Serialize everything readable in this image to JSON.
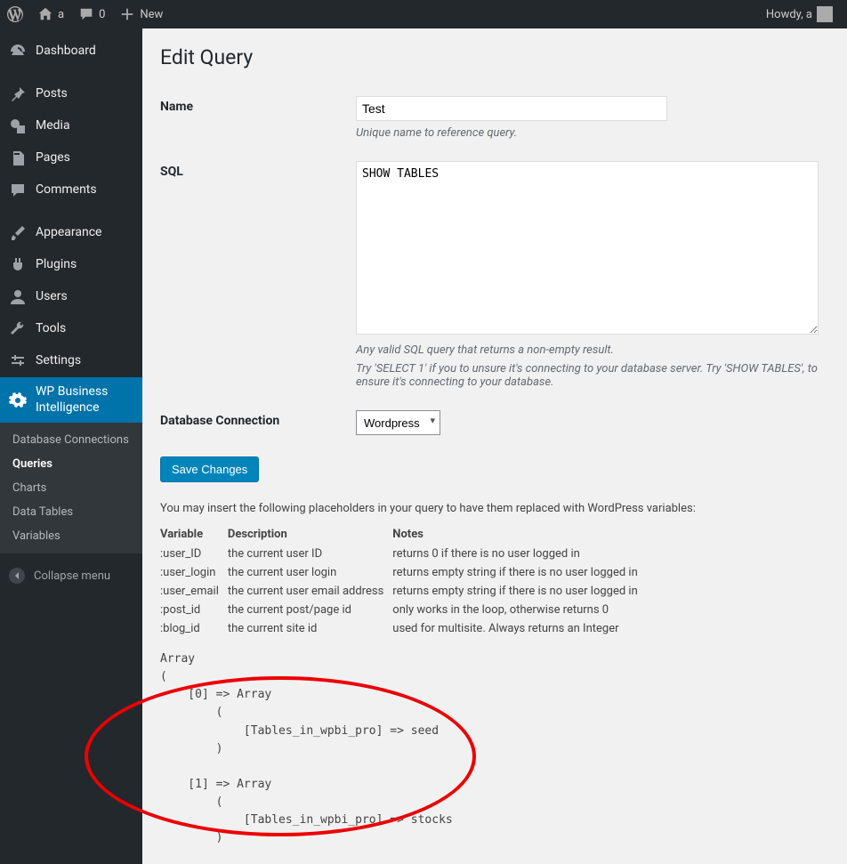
{
  "adminbar": {
    "site_name": "a",
    "comments_count": "0",
    "new_label": "New",
    "howdy": "Howdy, a"
  },
  "sidebar": {
    "items": [
      {
        "label": "Dashboard"
      },
      {
        "label": "Posts"
      },
      {
        "label": "Media"
      },
      {
        "label": "Pages"
      },
      {
        "label": "Comments"
      },
      {
        "label": "Appearance"
      },
      {
        "label": "Plugins"
      },
      {
        "label": "Users"
      },
      {
        "label": "Tools"
      },
      {
        "label": "Settings"
      },
      {
        "label": "WP Business Intelligence"
      }
    ],
    "sub": [
      {
        "label": "Database Connections"
      },
      {
        "label": "Queries"
      },
      {
        "label": "Charts"
      },
      {
        "label": "Data Tables"
      },
      {
        "label": "Variables"
      }
    ],
    "collapse": "Collapse menu"
  },
  "page": {
    "title": "Edit Query",
    "name_label": "Name",
    "name_value": "Test",
    "name_hint": "Unique name to reference query.",
    "sql_label": "SQL",
    "sql_value": "SHOW TABLES",
    "sql_hint1": "Any valid SQL query that returns a non-empty result.",
    "sql_hint2": "Try 'SELECT 1' if you to unsure it's connecting to your database server. Try 'SHOW TABLES', to ensure it's connecting to your database.",
    "db_label": "Database Connection",
    "db_value": "Wordpress",
    "save_label": "Save Changes",
    "placeholders_intro": "You may insert the following placeholders in your query to have them replaced with WordPress variables:",
    "vars_header": {
      "var": "Variable",
      "desc": "Description",
      "notes": "Notes"
    },
    "vars": [
      {
        "var": ":user_ID",
        "desc": "the current user ID",
        "notes": "returns 0 if there is no user logged in"
      },
      {
        "var": ":user_login",
        "desc": "the current user login",
        "notes": "returns empty string if there is no user logged in"
      },
      {
        "var": ":user_email",
        "desc": "the current user email address",
        "notes": "returns empty string if there is no user logged in"
      },
      {
        "var": ":post_id",
        "desc": "the current post/page id",
        "notes": "only works in the loop, otherwise returns 0"
      },
      {
        "var": ":blog_id",
        "desc": "the current site id",
        "notes": "used for multisite. Always returns an Integer"
      }
    ],
    "output": "Array\n(\n    [0] => Array\n        (\n            [Tables_in_wpbi_pro] => seed\n        )\n\n    [1] => Array\n        (\n            [Tables_in_wpbi_pro] => stocks\n        )"
  }
}
